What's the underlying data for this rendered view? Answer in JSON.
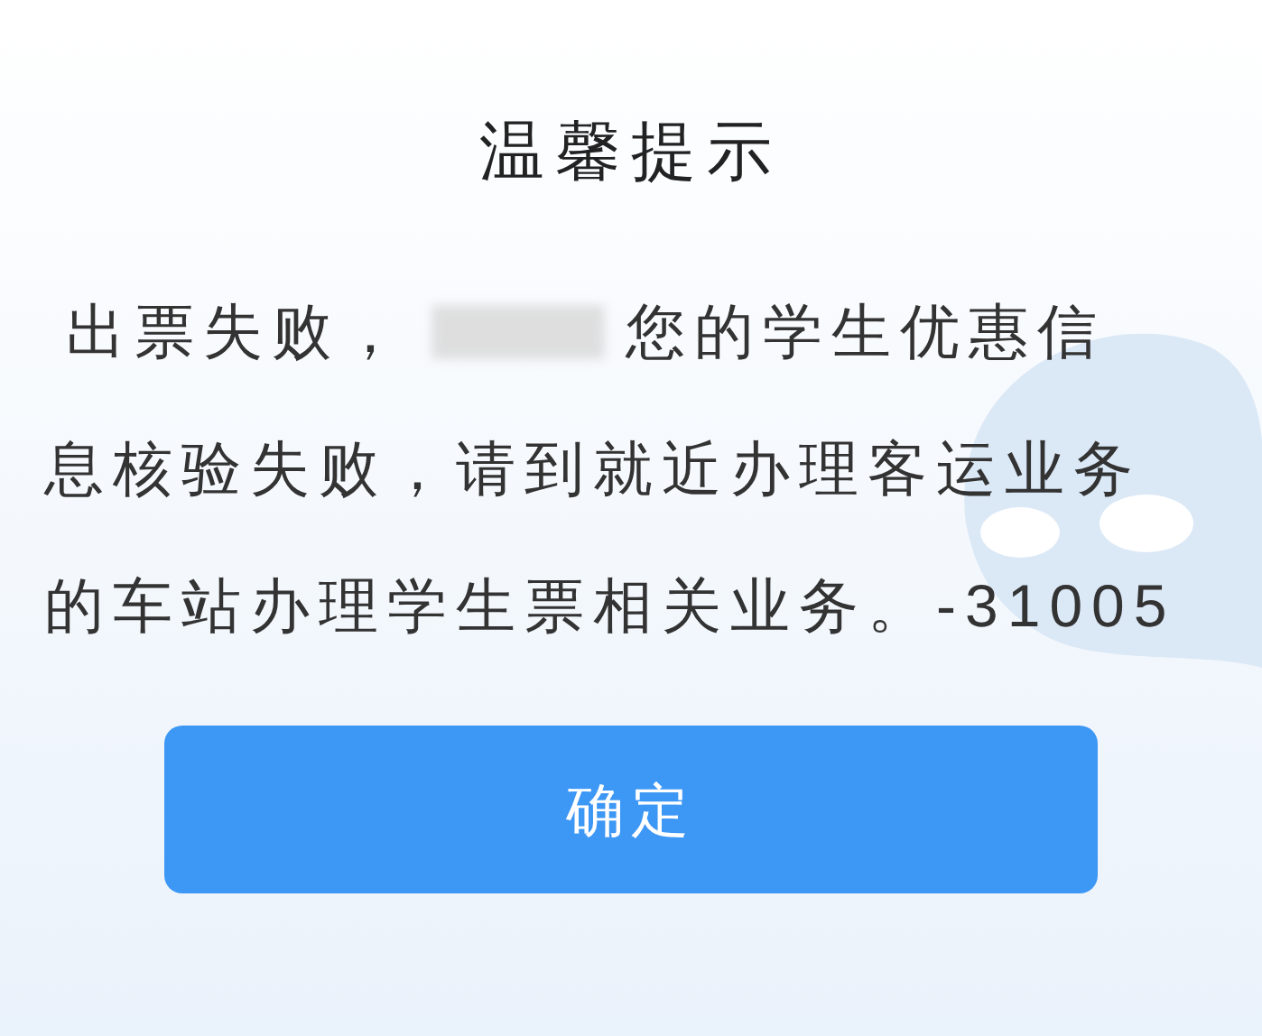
{
  "dialog": {
    "title": "温馨提示",
    "message": {
      "lines": [
        [
          {
            "kind": "text",
            "text": "出票失败，"
          },
          {
            "kind": "redaction"
          },
          {
            "kind": "text",
            "text": "您的学生优惠信"
          }
        ],
        [
          {
            "kind": "text",
            "text": "息核验失败，请到就近办理客运业务"
          }
        ],
        [
          {
            "kind": "text",
            "text": "的车站办理学生票相关业务。-31005"
          }
        ]
      ]
    },
    "buttons": [
      {
        "label": "确定"
      }
    ]
  }
}
